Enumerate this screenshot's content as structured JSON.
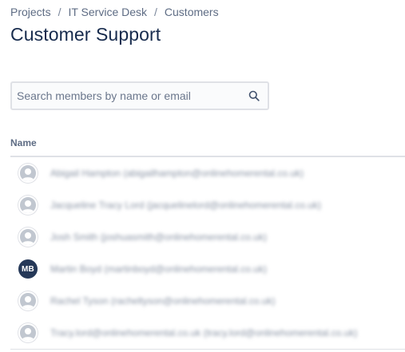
{
  "breadcrumb": {
    "items": [
      "Projects",
      "IT Service Desk",
      "Customers"
    ],
    "separator": "/"
  },
  "page_title": "Customer Support",
  "search": {
    "placeholder": "Search members by name or email",
    "value": ""
  },
  "table": {
    "column_header": "Name",
    "rows": [
      {
        "avatar": "default-avatar-icon",
        "name": "Abigail Hampton (abigailhampton@onlinehomerental.co.uk)"
      },
      {
        "avatar": "default-avatar-icon",
        "name": "Jacqueline Tracy Lord (jacquelinelord@onlinehomerental.co.uk)"
      },
      {
        "avatar": "default-avatar-icon",
        "name": "Josh Smith (joshuasmith@onlinehomerental.co.uk)"
      },
      {
        "avatar": "initials",
        "initials": "MB",
        "name": "Martin Boyd (martinboyd@onlinehomerental.co.uk)"
      },
      {
        "avatar": "default-avatar-icon",
        "name": "Rachel Tyson (racheltyson@onlinehomerental.co.uk)"
      },
      {
        "avatar": "default-avatar-icon",
        "name": "Tracy.lord@onlinehomerental.co.uk (tracy.lord@onlinehomerental.co.uk)"
      }
    ]
  },
  "colors": {
    "title": "#172B4D",
    "muted": "#5E6C84",
    "initials_avatar_bg": "#253858",
    "default_avatar_bg": "#C1C7D0",
    "border": "#DFE1E6"
  }
}
